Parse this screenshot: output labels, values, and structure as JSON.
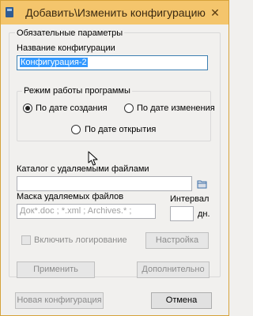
{
  "window": {
    "title": "Добавить\\Изменить конфигурацию",
    "close_glyph": "✕"
  },
  "required_params": {
    "group_title": "Обязательные параметры",
    "config_name_label": "Название конфигурации",
    "config_name_value": "Конфигурация-2"
  },
  "mode": {
    "group_title": "Режим работы программы",
    "options": [
      {
        "label": "По дате создания",
        "checked": true
      },
      {
        "label": "По дате изменения",
        "checked": false
      },
      {
        "label": "По дате открытия",
        "checked": false
      }
    ]
  },
  "catalog": {
    "label": "Каталог с удаляемыми файлами",
    "value": "",
    "browse_icon": "folder-icon"
  },
  "mask": {
    "label": "Маска удаляемых файлов",
    "placeholder": "Док*.doc ; *.xml ; Archives.* ;",
    "value": ""
  },
  "interval": {
    "label": "Интервал",
    "value": "",
    "unit": "дн."
  },
  "logging": {
    "label": "Включить логирование",
    "checked": false,
    "enabled": false
  },
  "buttons": {
    "settings": "Настройка",
    "apply": "Применить",
    "advanced": "Дополнительно",
    "new_config": "Новая конфигурация",
    "cancel": "Отмена"
  },
  "colors": {
    "titlebar": "#f4c56c",
    "selection": "#3399ff",
    "window_bg": "#f1f0ee"
  }
}
